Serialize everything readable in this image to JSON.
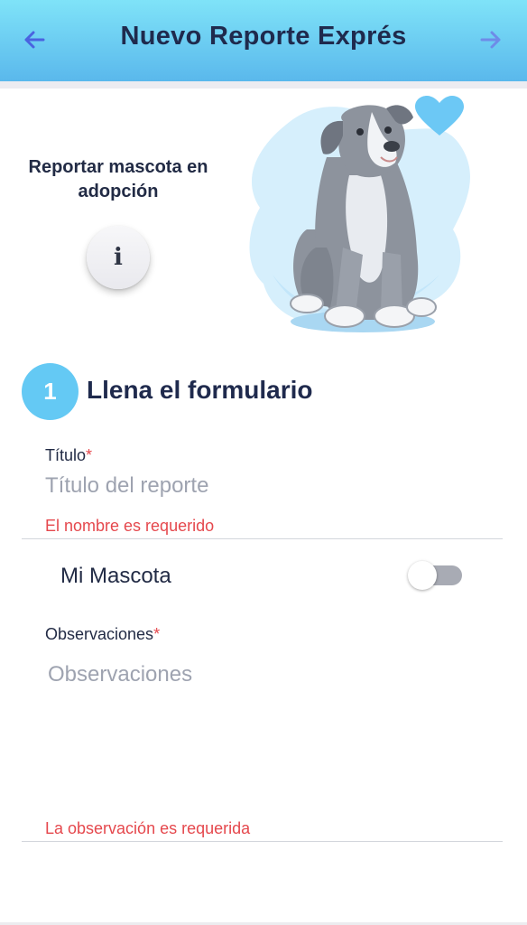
{
  "header": {
    "title": "Nuevo Reporte Exprés",
    "back_icon": "arrow-left-icon",
    "forward_icon": "arrow-right-icon",
    "gradient": [
      "#7fe3f8",
      "#5ab8ec"
    ]
  },
  "adoption": {
    "label": "Reportar mascota en adopción",
    "info_button_glyph": "i",
    "info_icon": "info-icon"
  },
  "illustration": {
    "subject": "puppy-illustration",
    "accent_color": "#6cc8f5"
  },
  "step": {
    "number": "1",
    "title": "Llena el formulario",
    "color": "#64c9f4"
  },
  "form": {
    "title_field": {
      "label": "Título",
      "required_mark": "*",
      "value": "",
      "placeholder": "Título del reporte",
      "error": "El nombre es requerido"
    },
    "pet_toggle": {
      "label": "Mi Mascota",
      "on": false
    },
    "observations_field": {
      "label": "Observaciones",
      "required_mark": "*",
      "value": "",
      "placeholder": "Observaciones",
      "error": "La observación es requerida"
    }
  },
  "colors": {
    "error": "#e5484d",
    "text": "#222b45",
    "placeholder": "#9ea3b0"
  }
}
